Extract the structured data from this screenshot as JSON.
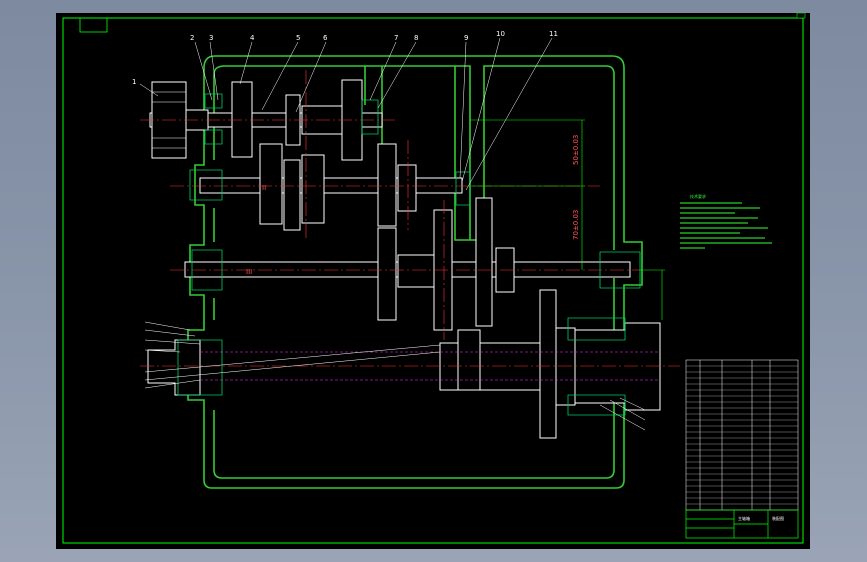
{
  "colors": {
    "viewport_bg": "#8a96aa",
    "paper": "#000000",
    "frame": "#00ff00",
    "housing": "#33cc33",
    "shaft": "#ffffff",
    "centerline": "#ff3333",
    "gear": "#00cc66",
    "hidden": "#ff33ff",
    "annotation": "#00ff00"
  },
  "balloons": [
    "1",
    "2",
    "3",
    "4",
    "5",
    "6",
    "7",
    "8",
    "9",
    "10",
    "11"
  ],
  "shaft_labels": [
    "II",
    "III"
  ],
  "dimensions": [
    "50±0.03",
    "70±0.03"
  ],
  "notes_title": "技术要求",
  "title_block": {
    "part_label": "主轴箱",
    "drawing_label": "装配图"
  }
}
